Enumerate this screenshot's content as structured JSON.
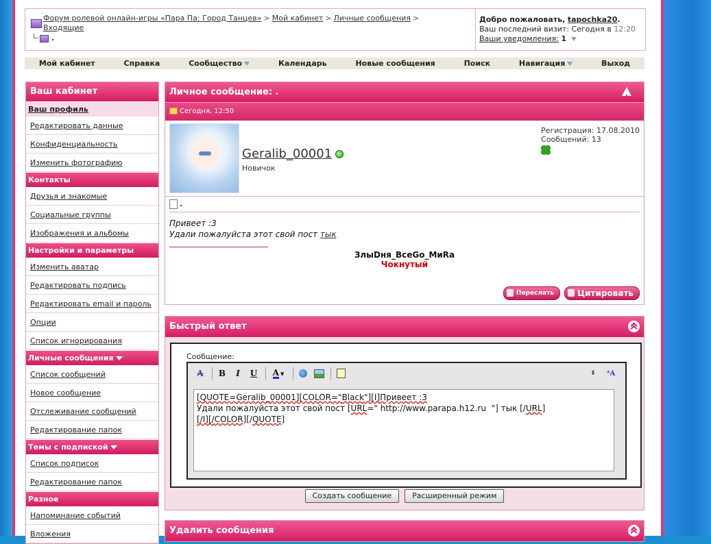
{
  "breadcrumb": {
    "forum": "Форум ролевой онлайн-игры «Пара Па: Город Танцев»",
    "cabinet": "Мой кабинет",
    "pm": "Личные сообщения",
    "inbox": "Входящие",
    "current": "."
  },
  "welcome": {
    "greeting": "Добро пожаловать,",
    "username": "tapochka20",
    "last_visit_label": "Ваш последний визит: Сегодня в",
    "last_visit_time": "12:20",
    "notifications_label": "Ваши уведомления:",
    "notifications_count": "1"
  },
  "navbar": {
    "cabinet": "Мой кабинет",
    "help": "Справка",
    "community": "Сообщество",
    "calendar": "Календарь",
    "new_posts": "Новые сообщения",
    "search": "Поиск",
    "navigation": "Навигация",
    "logout": "Выход"
  },
  "sidebar": {
    "title": "Ваш кабинет",
    "sections": [
      {
        "title": "Ваш профиль",
        "items": [
          "Редактировать данные",
          "Конфиденциальность",
          "Изменить фотографию"
        ]
      },
      {
        "title": "Контакты",
        "items": [
          "Друзья и знакомые",
          "Социальные группы",
          "Изображения и альбомы"
        ]
      },
      {
        "title": "Настройки и параметры",
        "items": [
          "Изменить аватар",
          "Редактировать подпись",
          "Редактировать email и пароль",
          "Опции",
          "Список игнорирования"
        ]
      },
      {
        "title": "Личные сообщения",
        "items": [
          "Список сообщений",
          "Новое сообщение",
          "Отслеживание сообщений",
          "Редактирование папок"
        ]
      },
      {
        "title": "Темы с подпиской",
        "items": [
          "Список подписок",
          "Редактирование папок"
        ]
      },
      {
        "title": "Разное",
        "items": [
          "Напоминание событий",
          "Вложения"
        ]
      }
    ]
  },
  "message": {
    "title": "Личное сообщение: .",
    "date": "Сегодня, 12:50",
    "author": "Geralib_00001",
    "rank": "Новичок",
    "registration": "Регистрация: 17.08.2010",
    "posts": "Сообщений: 13",
    "subject": ".",
    "line1": "Привеет :3",
    "line2": "Удали пожалуйста этот свой пост",
    "link": "тык",
    "sig1": "ЗлыDня_BceGo_MиRa",
    "sig2": "Чокнутый",
    "forward": "Переслать",
    "quote": "Цитировать"
  },
  "quick_reply": {
    "title": "Быстрый ответ",
    "label": "Сообщение:",
    "text_line1_parts": [
      "[QUOTE=Geralib_00001][COLOR=\"",
      "Black",
      "\"][I]Привеет :3"
    ],
    "text_line2_parts": [
      "Удали пожалуйста этот свой пост [",
      "URL",
      "=\" http://www.parapa.h12.ru  \"] тык [/",
      "URL",
      "]"
    ],
    "text_line3_parts": [
      "[/I][/",
      "COLOR",
      "][/",
      "QUOTE",
      "]"
    ],
    "submit": "Создать сообщение",
    "advanced": "Расширенный режим"
  },
  "delete_box": {
    "title": "Удалить сообщения"
  },
  "colors": {
    "accent": "#d51d63",
    "accent_light": "#f05a92",
    "background": "#1c8fd0"
  }
}
